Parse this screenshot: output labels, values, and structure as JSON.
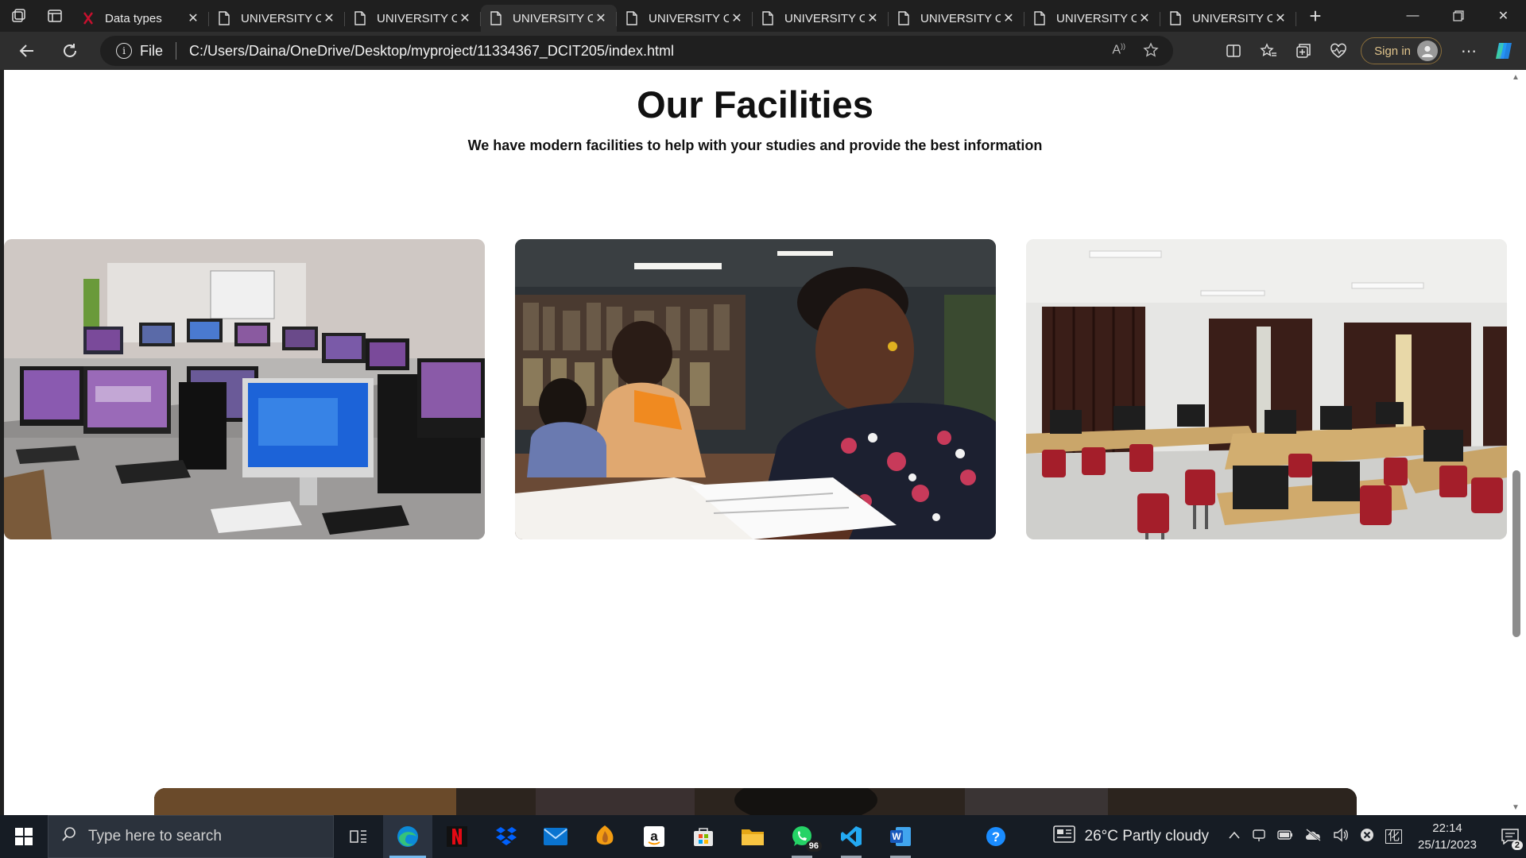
{
  "browser": {
    "tabs": [
      {
        "title": "Data types",
        "active": false,
        "favicon": "red-x-icon"
      },
      {
        "title": "UNIVERSITY OF",
        "active": false,
        "favicon": "page-icon"
      },
      {
        "title": "UNIVERSITY OF",
        "active": false,
        "favicon": "page-icon"
      },
      {
        "title": "UNIVERSITY OF",
        "active": true,
        "favicon": "page-icon"
      },
      {
        "title": "UNIVERSITY OF",
        "active": false,
        "favicon": "page-icon"
      },
      {
        "title": "UNIVERSITY OF",
        "active": false,
        "favicon": "page-icon"
      },
      {
        "title": "UNIVERSITY OF",
        "active": false,
        "favicon": "page-icon"
      },
      {
        "title": "UNIVERSITY OF",
        "active": false,
        "favicon": "page-icon"
      },
      {
        "title": "UNIVERSITY OF",
        "active": false,
        "favicon": "page-icon"
      }
    ],
    "address": {
      "scheme_label": "File",
      "url": "C:/Users/Daina/OneDrive/Desktop/myproject/11334367_DCIT205/index.html"
    },
    "signin_label": "Sign in",
    "accent": "#e0c48c"
  },
  "page": {
    "title": "Our Facilities",
    "subtitle": "We have modern facilities to help with your studies and provide the best information",
    "facilities": [
      {
        "image": "computer-lab-photo"
      },
      {
        "image": "library-study-photo"
      },
      {
        "image": "classroom-photo"
      }
    ]
  },
  "taskbar": {
    "search_placeholder": "Type here to search",
    "whatsapp_badge": "96",
    "weather": "26°C  Partly cloudy",
    "time": "22:14",
    "date": "25/11/2023",
    "notifications": "2"
  }
}
